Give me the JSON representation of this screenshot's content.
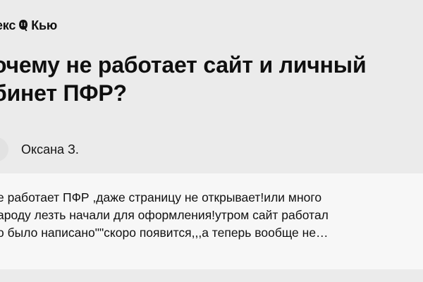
{
  "header": {
    "brand_left": "екс",
    "logo_icon": "yandex-q-icon",
    "brand_right": "Кью"
  },
  "question": {
    "title": "очему не работает сайт и личный бинет ПФР?",
    "title_lines": [
      "очему не работает сайт и личный",
      "бинет ПФР?"
    ],
    "author": "Оксана З.",
    "body_lines": [
      "е работает ПФР ,даже страницу не открывает!или много",
      "ароду лезть начали для оформления!утром сайт работал",
      "о было написано\"\"скоро появится,,,а теперь вообще не…"
    ]
  },
  "colors": {
    "page_background": "#ebebeb",
    "card_background": "#f7f7f7",
    "text": "#111111"
  }
}
